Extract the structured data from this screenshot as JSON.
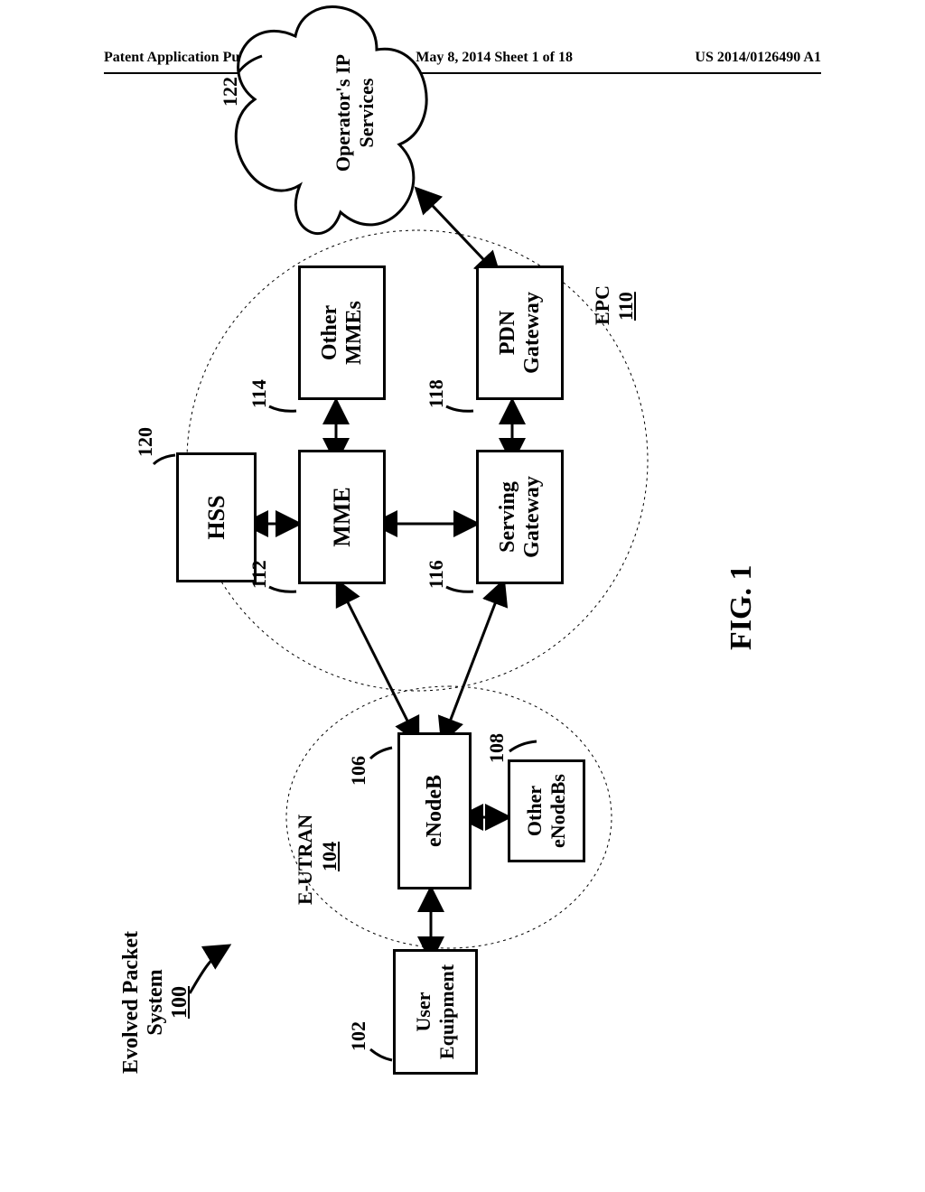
{
  "header": {
    "left": "Patent Application Publication",
    "mid": "May 8, 2014  Sheet 1 of 18",
    "right": "US 2014/0126490 A1"
  },
  "title": {
    "t1": "Evolved Packet",
    "t2": "System",
    "t3": "100"
  },
  "groups": {
    "eutran": {
      "name": "E-UTRAN",
      "num": "104"
    },
    "epc": {
      "name": "EPC",
      "num": "110"
    }
  },
  "nodes": {
    "ue": {
      "l1": "User",
      "l2": "Equipment",
      "ref": "102"
    },
    "enb": {
      "l1": "eNodeB",
      "l2": "",
      "ref": "106"
    },
    "oenb": {
      "l1": "Other",
      "l2": "eNodeBs",
      "ref": "108"
    },
    "hss": {
      "l1": "HSS",
      "l2": "",
      "ref": "120"
    },
    "mme": {
      "l1": "MME",
      "l2": "",
      "ref": "112"
    },
    "omme": {
      "l1": "Other",
      "l2": "MMEs",
      "ref": "114"
    },
    "sgw": {
      "l1": "Serving",
      "l2": "Gateway",
      "ref": "116"
    },
    "pgw": {
      "l1": "PDN",
      "l2": "Gateway",
      "ref": "118"
    },
    "cloud": {
      "l1": "Operator's IP",
      "l2": "Services",
      "ref": "122"
    }
  },
  "fig": "FIG. 1"
}
